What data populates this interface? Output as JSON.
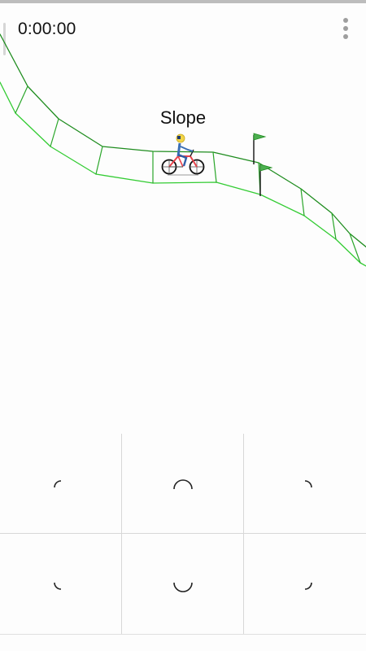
{
  "hud": {
    "timer": "0:00:00",
    "menu_icon": "more-vert-icon"
  },
  "level": {
    "name": "Slope"
  },
  "colors": {
    "track_light": "#33cc33",
    "track_dark": "#1e8c1e",
    "flag": "#4caf50",
    "pole": "#111111",
    "grid": "#d8d8d8"
  },
  "controls": {
    "buttons": [
      {
        "name": "lean-back-accelerate-button",
        "icon": "arc-top-left-icon"
      },
      {
        "name": "accelerate-button",
        "icon": "arc-top-icon"
      },
      {
        "name": "lean-forward-accelerate-button",
        "icon": "arc-top-right-icon"
      },
      {
        "name": "lean-back-brake-button",
        "icon": "arc-bottom-left-icon"
      },
      {
        "name": "brake-button",
        "icon": "arc-bottom-icon"
      },
      {
        "name": "lean-forward-brake-button",
        "icon": "arc-bottom-right-icon"
      }
    ]
  }
}
